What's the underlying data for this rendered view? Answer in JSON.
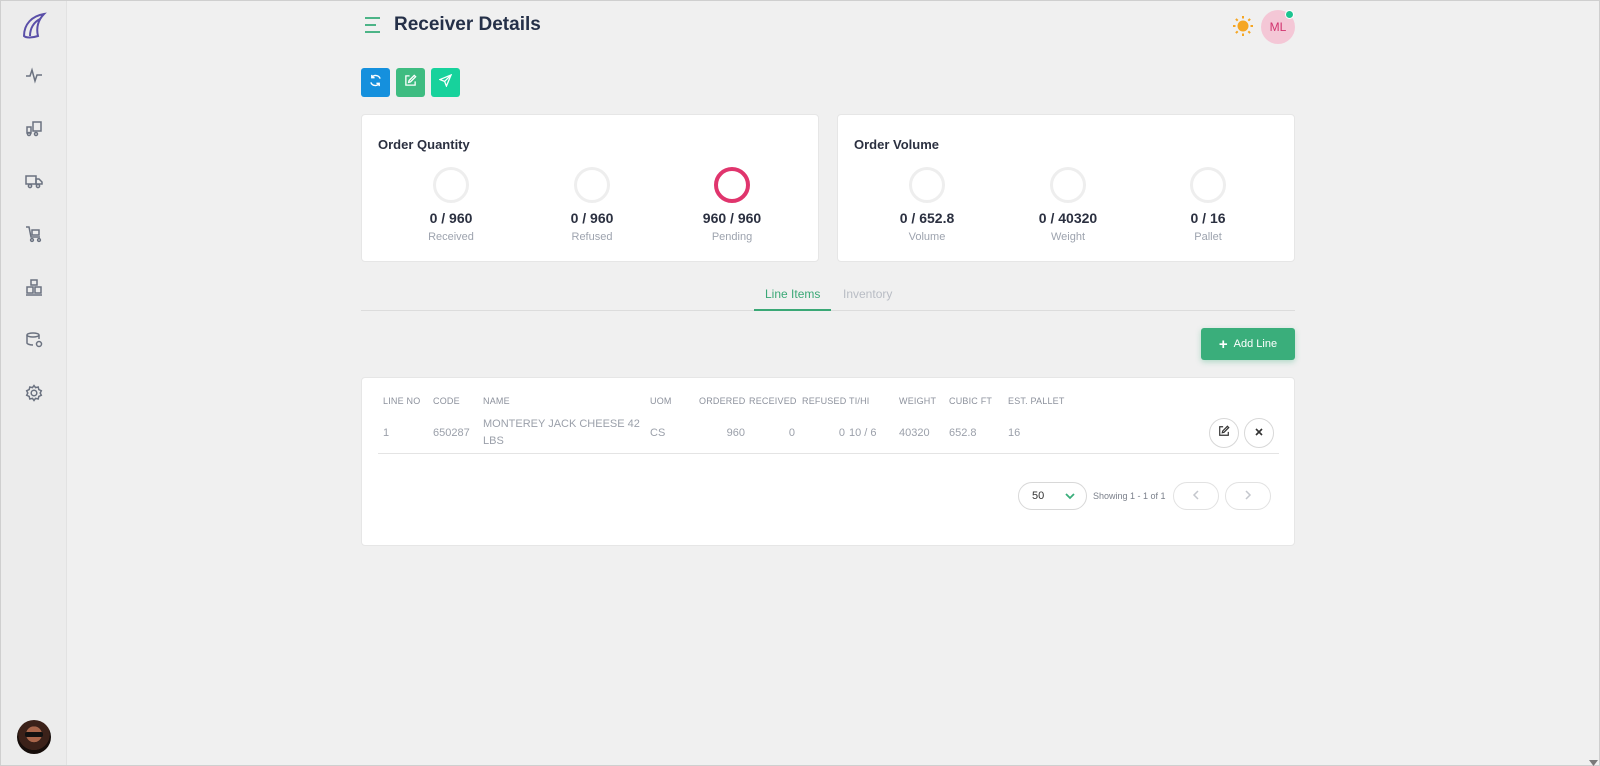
{
  "header": {
    "title": "Receiver Details",
    "user_initials": "ML"
  },
  "sidebar": {
    "items": [
      {
        "icon": "activity-icon"
      },
      {
        "icon": "forklift-icon"
      },
      {
        "icon": "truck-icon"
      },
      {
        "icon": "cart-icon"
      },
      {
        "icon": "warehouse-icon"
      },
      {
        "icon": "database-settings-icon"
      },
      {
        "icon": "gear-icon"
      }
    ]
  },
  "toolbar": {
    "buttons": [
      "refresh-icon",
      "edit-icon",
      "send-icon"
    ]
  },
  "order_quantity": {
    "title": "Order Quantity",
    "metrics": [
      {
        "value": "0 / 960",
        "label": "Received",
        "progress": 0
      },
      {
        "value": "0 / 960",
        "label": "Refused",
        "progress": 0
      },
      {
        "value": "960 / 960",
        "label": "Pending",
        "progress": 1
      }
    ]
  },
  "order_volume": {
    "title": "Order Volume",
    "metrics": [
      {
        "value": "0 / 652.8",
        "label": "Volume",
        "progress": 0
      },
      {
        "value": "0 / 40320",
        "label": "Weight",
        "progress": 0
      },
      {
        "value": "0 / 16",
        "label": "Pallet",
        "progress": 0
      }
    ]
  },
  "tabs": [
    {
      "label": "Line Items",
      "active": true
    },
    {
      "label": "Inventory",
      "active": false
    }
  ],
  "add_line_label": "Add Line",
  "table": {
    "columns": [
      "LINE NO",
      "CODE",
      "NAME",
      "UOM",
      "ORDERED",
      "RECEIVED",
      "REFUSED",
      "TI/HI",
      "WEIGHT",
      "CUBIC FT",
      "EST. PALLET"
    ],
    "rows": [
      {
        "line_no": "1",
        "code": "650287",
        "name_line1": "MONTEREY JACK CHEESE 42",
        "name_line2": "LBS",
        "uom": "CS",
        "ordered": "960",
        "received": "0",
        "refused": "0",
        "tihi": "10 / 6",
        "weight": "40320",
        "cubic_ft": "652.8",
        "est_pallet": "16"
      }
    ]
  },
  "pagination": {
    "page_size": "50",
    "showing": "Showing 1 - 1 of 1"
  },
  "colors": {
    "accent_green": "#3aae7b",
    "refresh_blue": "#1590dd",
    "pending_ring": "#e0356d",
    "sun": "#f5a623"
  }
}
